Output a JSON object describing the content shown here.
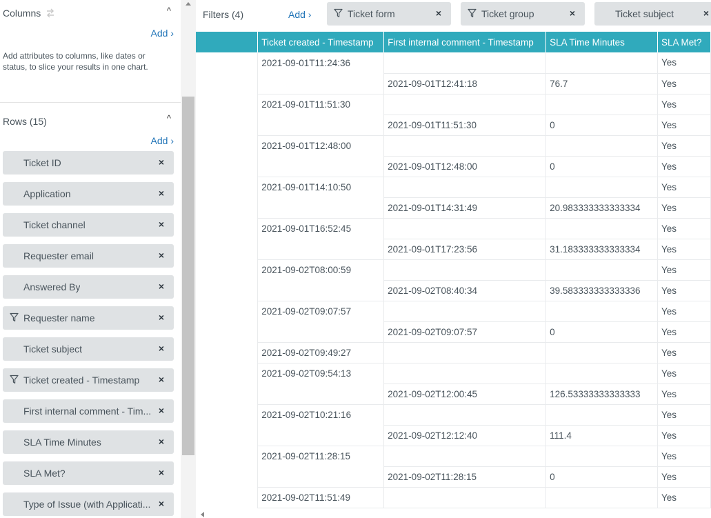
{
  "columns_section": {
    "title": "Columns",
    "add_label": "Add ›",
    "help": "Add attributes to columns, like dates or status, to slice your results in one chart."
  },
  "rows_section": {
    "title": "Rows (15)",
    "add_label": "Add ›",
    "items": [
      {
        "label": "Ticket ID",
        "filtered": false
      },
      {
        "label": "Application",
        "filtered": false
      },
      {
        "label": "Ticket channel",
        "filtered": false
      },
      {
        "label": "Requester email",
        "filtered": false
      },
      {
        "label": "Answered By",
        "filtered": false
      },
      {
        "label": "Requester name",
        "filtered": true
      },
      {
        "label": "Ticket subject",
        "filtered": false
      },
      {
        "label": "Ticket created - Timestamp",
        "filtered": true
      },
      {
        "label": "First internal comment - Tim...",
        "filtered": false
      },
      {
        "label": "SLA Time Minutes",
        "filtered": false
      },
      {
        "label": "SLA Met?",
        "filtered": false
      },
      {
        "label": "Type of Issue (with Applicati...",
        "filtered": false
      }
    ]
  },
  "filters": {
    "title": "Filters (4)",
    "add_label": "Add ›",
    "chips": [
      {
        "label": "Ticket form",
        "filtered": true
      },
      {
        "label": "Ticket group",
        "filtered": true
      },
      {
        "label": "Ticket subject",
        "filtered": false
      }
    ]
  },
  "table": {
    "headers": [
      "",
      "Ticket created - Timestamp",
      "First internal comment - Timestamp",
      "SLA Time Minutes",
      "SLA Met?"
    ],
    "rows": [
      [
        "",
        "2021-09-01T11:24:36",
        "",
        "",
        "Yes"
      ],
      [
        "",
        "",
        "2021-09-01T12:41:18",
        "76.7",
        "Yes"
      ],
      [
        "",
        "2021-09-01T11:51:30",
        "",
        "",
        "Yes"
      ],
      [
        "",
        "",
        "2021-09-01T11:51:30",
        "0",
        "Yes"
      ],
      [
        "",
        "2021-09-01T12:48:00",
        "",
        "",
        "Yes"
      ],
      [
        "",
        "",
        "2021-09-01T12:48:00",
        "0",
        "Yes"
      ],
      [
        "",
        "2021-09-01T14:10:50",
        "",
        "",
        "Yes"
      ],
      [
        "",
        "",
        "2021-09-01T14:31:49",
        "20.983333333333334",
        "Yes"
      ],
      [
        "",
        "2021-09-01T16:52:45",
        "",
        "",
        "Yes"
      ],
      [
        "",
        "",
        "2021-09-01T17:23:56",
        "31.183333333333334",
        "Yes"
      ],
      [
        "",
        "2021-09-02T08:00:59",
        "",
        "",
        "Yes"
      ],
      [
        "",
        "",
        "2021-09-02T08:40:34",
        "39.583333333333336",
        "Yes"
      ],
      [
        "",
        "2021-09-02T09:07:57",
        "",
        "",
        "Yes"
      ],
      [
        "",
        "",
        "2021-09-02T09:07:57",
        "0",
        "Yes"
      ],
      [
        "",
        "2021-09-02T09:49:27",
        "",
        "",
        "Yes"
      ],
      [
        "",
        "2021-09-02T09:54:13",
        "",
        "",
        "Yes"
      ],
      [
        "",
        "",
        "2021-09-02T12:00:45",
        "126.53333333333333",
        "Yes"
      ],
      [
        "",
        "2021-09-02T10:21:16",
        "",
        "",
        "Yes"
      ],
      [
        "",
        "",
        "2021-09-02T12:12:40",
        "111.4",
        "Yes"
      ],
      [
        "",
        "2021-09-02T11:28:15",
        "",
        "",
        "Yes"
      ],
      [
        "",
        "",
        "2021-09-02T11:28:15",
        "0",
        "Yes"
      ],
      [
        "",
        "2021-09-02T11:51:49",
        "",
        "",
        "Yes"
      ]
    ]
  },
  "colors": {
    "header_bg": "#30aabc",
    "link": "#1f73b7",
    "chip_bg": "#dfe2e4"
  }
}
